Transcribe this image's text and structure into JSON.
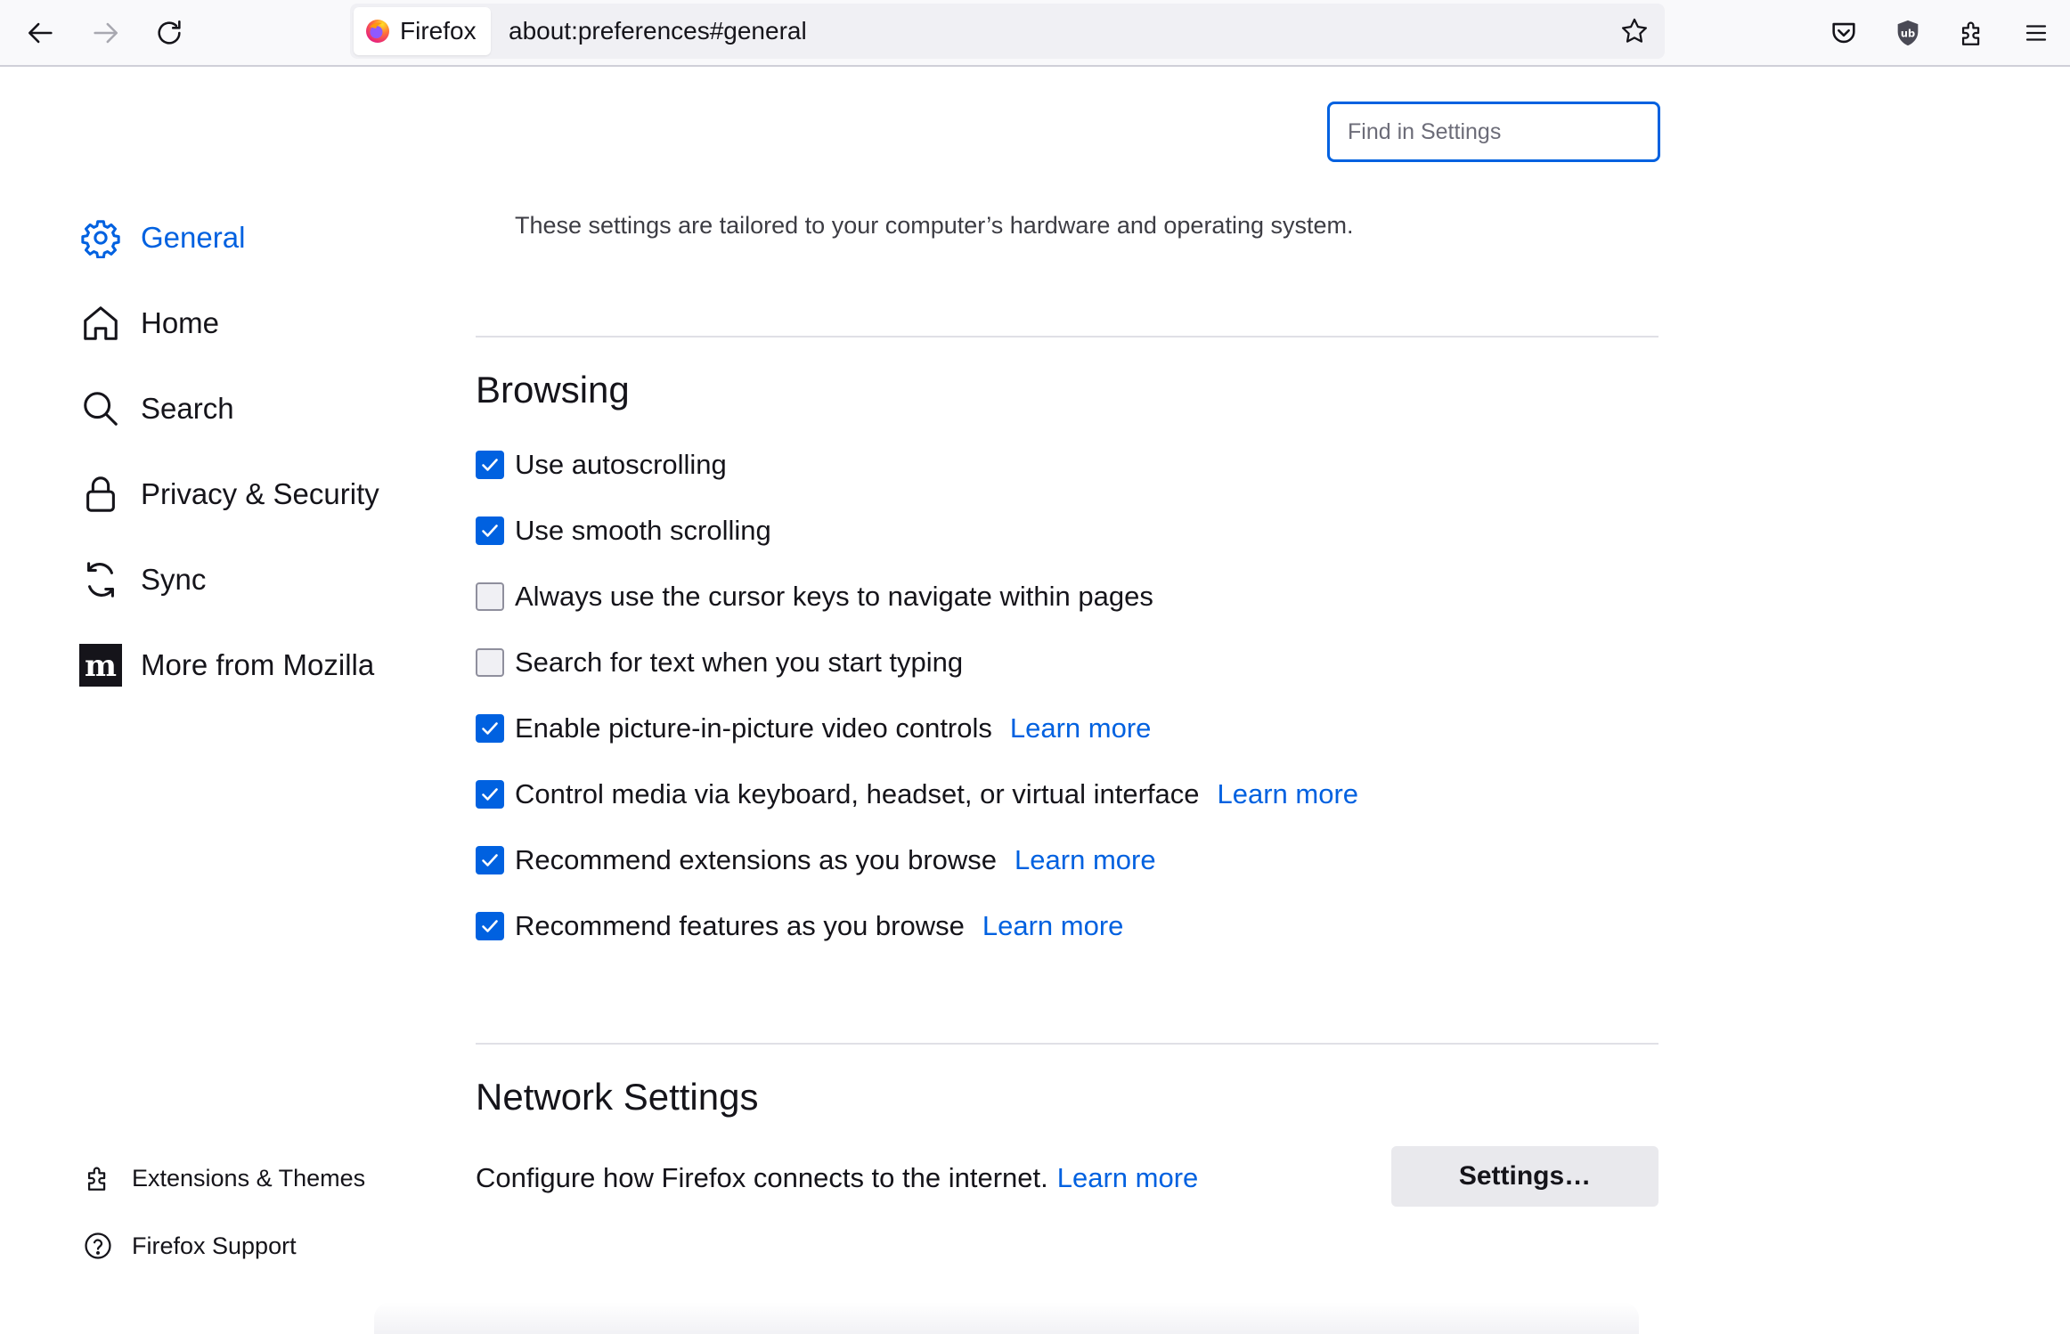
{
  "toolbar": {
    "identity_label": "Firefox",
    "url": "about:preferences#general",
    "icons": [
      "back-arrow-icon",
      "forward-arrow-icon",
      "reload-icon",
      "bookmark-star-icon",
      "pocket-icon",
      "ublock-shield-icon",
      "extensions-puzzle-icon",
      "hamburger-menu-icon"
    ]
  },
  "sidebar": {
    "categories": [
      {
        "label": "General",
        "icon": "gear-icon",
        "selected": true
      },
      {
        "label": "Home",
        "icon": "home-icon"
      },
      {
        "label": "Search",
        "icon": "search-icon"
      },
      {
        "label": "Privacy & Security",
        "icon": "lock-icon"
      },
      {
        "label": "Sync",
        "icon": "sync-icon"
      },
      {
        "label": "More from Mozilla",
        "icon": "mozilla-m-icon"
      }
    ],
    "footer": [
      {
        "label": "Extensions & Themes",
        "icon": "puzzle-icon"
      },
      {
        "label": "Firefox Support",
        "icon": "help-circle-icon"
      }
    ]
  },
  "search": {
    "placeholder": "Find in Settings"
  },
  "main": {
    "info_text": "These settings are tailored to your computer’s hardware and operating system.",
    "browsing": {
      "title": "Browsing",
      "options": [
        {
          "label": "Use autoscrolling",
          "checked": true
        },
        {
          "label": "Use smooth scrolling",
          "checked": true
        },
        {
          "label": "Always use the cursor keys to navigate within pages",
          "checked": false
        },
        {
          "label": "Search for text when you start typing",
          "checked": false
        },
        {
          "label": "Enable picture-in-picture video controls",
          "checked": true,
          "learn_more": "Learn more"
        },
        {
          "label": "Control media via keyboard, headset, or virtual interface",
          "checked": true,
          "learn_more": "Learn more"
        },
        {
          "label": "Recommend extensions as you browse",
          "checked": true,
          "learn_more": "Learn more"
        },
        {
          "label": "Recommend features as you browse",
          "checked": true,
          "learn_more": "Learn more"
        }
      ]
    },
    "network": {
      "title": "Network Settings",
      "description": "Configure how Firefox connects to the internet.",
      "learn_more": "Learn more",
      "button_label": "Settings…"
    }
  },
  "colors": {
    "accent": "#0061e0",
    "text": "#15141a",
    "toolbar_bg": "#f9f9fb",
    "button_bg": "#e9e9ed"
  }
}
